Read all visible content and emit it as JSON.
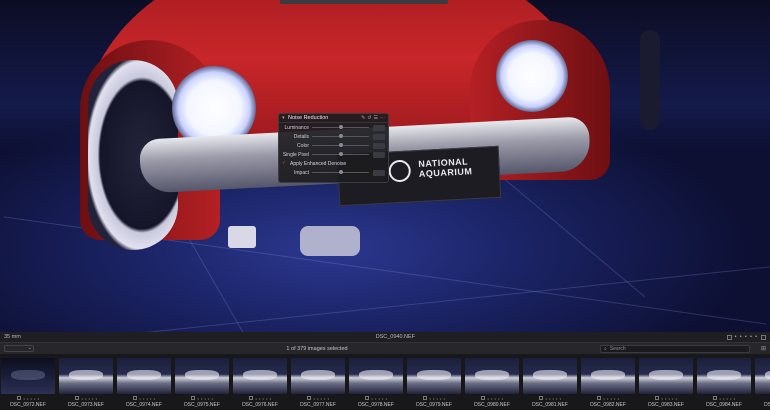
{
  "noise_reduction": {
    "title": "Noise Reduction",
    "sliders": [
      {
        "label": "Luminance",
        "value": 0.5
      },
      {
        "label": "Details",
        "value": 0.5
      },
      {
        "label": "Color",
        "value": 0.5
      },
      {
        "label": "Single Pixel",
        "value": 0.5
      }
    ],
    "enhanced_checkbox_label": "Apply Enhanced Denoise",
    "impact_label": "Impact",
    "impact_value": 0.5
  },
  "plate": {
    "line1": "NATIONAL",
    "line2": "AQUARIUM"
  },
  "info_strip": {
    "focal_length": "35 mm",
    "filename": "DSC_0940.NEF"
  },
  "browser_bar": {
    "selection_status": "1 of 379 images selected",
    "search_placeholder": "Search"
  },
  "filmstrip": {
    "items": [
      {
        "name": "DSC_0972.NEF",
        "tone": "dark"
      },
      {
        "name": "DSC_0973.NEF",
        "tone": "light"
      },
      {
        "name": "DSC_0974.NEF",
        "tone": "light"
      },
      {
        "name": "DSC_0975.NEF",
        "tone": "light"
      },
      {
        "name": "DSC_0976.NEF",
        "tone": "light"
      },
      {
        "name": "DSC_0977.NEF",
        "tone": "light"
      },
      {
        "name": "DSC_0978.NEF",
        "tone": "light"
      },
      {
        "name": "DSC_0979.NEF",
        "tone": "light"
      },
      {
        "name": "DSC_0980.NEF",
        "tone": "light"
      },
      {
        "name": "DSC_0981.NEF",
        "tone": "light"
      },
      {
        "name": "DSC_0982.NEF",
        "tone": "light"
      },
      {
        "name": "DSC_0983.NEF",
        "tone": "light"
      },
      {
        "name": "DSC_0984.NEF",
        "tone": "light"
      },
      {
        "name": "DSC_0985.NEF",
        "tone": "light"
      }
    ]
  }
}
